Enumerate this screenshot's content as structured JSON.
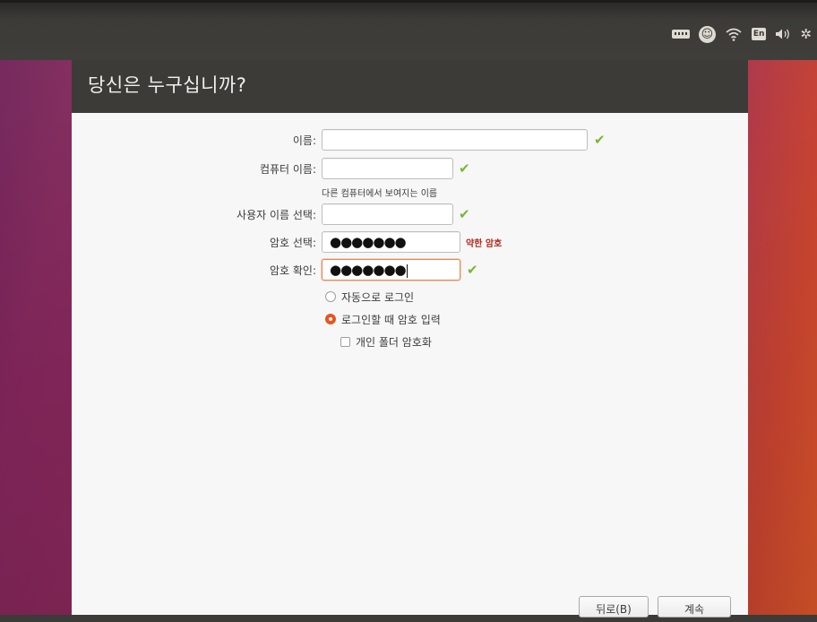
{
  "window": {
    "title": "당신은 누구십니까?"
  },
  "panel": {
    "lang": "En"
  },
  "form": {
    "name": {
      "label": "이름:",
      "value": ""
    },
    "computer": {
      "label": "컴퓨터 이름:",
      "value": "",
      "hint": "다른 컴퓨터에서 보여지는 이름"
    },
    "username": {
      "label": "사용자 이름 선택:",
      "value": ""
    },
    "password": {
      "label": "암호 선택:",
      "masked": "●●●●●●●",
      "strength": "약한 암호"
    },
    "confirm": {
      "label": "암호 확인:",
      "masked": "●●●●●●●"
    },
    "auto_login": {
      "label": "자동으로 로그인",
      "selected": false
    },
    "require_password": {
      "label": "로그인할 때 암호 입력",
      "selected": true
    },
    "encrypt_home": {
      "label": "개인 폴더 암호화",
      "checked": false
    }
  },
  "buttons": {
    "back": "뒤로(B)",
    "continue": "계속"
  },
  "colors": {
    "accent": "#e9541f",
    "check": "#79b636",
    "weak": "#b52a1e"
  }
}
